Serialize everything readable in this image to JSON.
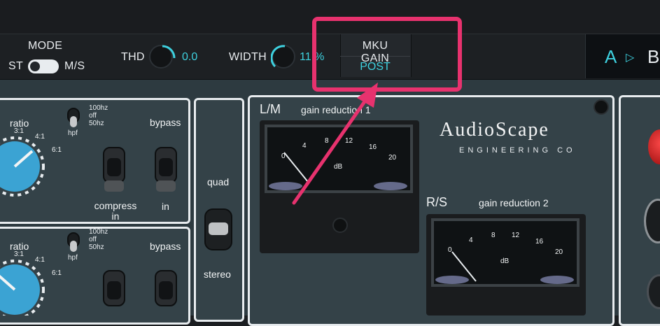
{
  "toolbar": {
    "mode": {
      "label": "MODE",
      "left_option": "ST",
      "right_option": "M/S"
    },
    "thd": {
      "label": "THD",
      "value": "0.0"
    },
    "width": {
      "label": "WIDTH",
      "value": "11%",
      "value_visible": "11",
      "unit": "%"
    },
    "mku_gain": {
      "label": "MKU GAIN",
      "value": "POST"
    },
    "ab": {
      "a": "A",
      "arrow": "▷",
      "b": "B"
    }
  },
  "hardware": {
    "channel1": {
      "ratio_label": "ratio",
      "ratio_ticks": [
        "3:1",
        "4:1",
        "6:1"
      ],
      "hpf_options": [
        "100hz",
        "off",
        "50hz"
      ],
      "hpf_label": "hpf",
      "bypass_label": "bypass",
      "compress_label": "compress in",
      "in_label": "in"
    },
    "channel2": {
      "ratio_label": "ratio",
      "ratio_ticks": [
        "3:1",
        "4:1",
        "6:1"
      ],
      "hpf_options": [
        "100hz",
        "off",
        "50hz"
      ],
      "hpf_label": "hpf",
      "bypass_label": "bypass"
    },
    "link": {
      "quad_label": "quad",
      "stereo_label": "stereo"
    },
    "meter1": {
      "channel_label": "L/M",
      "title": "gain reduction 1",
      "scale": [
        "0",
        "4",
        "8",
        "12",
        "16",
        "20"
      ],
      "unit": "dB"
    },
    "meter2": {
      "channel_label": "R/S",
      "title": "gain reduction 2",
      "scale": [
        "0",
        "4",
        "8",
        "12",
        "16",
        "20"
      ],
      "unit": "dB"
    },
    "brand": {
      "name": "AudioScape",
      "subtitle": "ENGINEERING CO"
    }
  },
  "colors": {
    "accent": "#3ed1df",
    "highlight": "#e7326e",
    "panel": "#344248",
    "knob_blue": "#3ba3d3"
  }
}
